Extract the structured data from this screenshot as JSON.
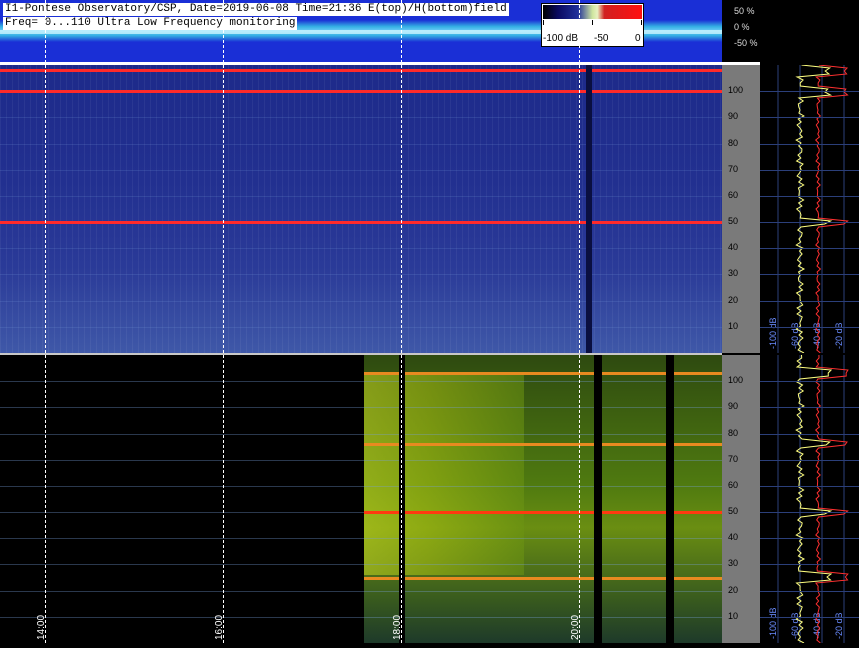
{
  "header": {
    "line1": "I1-Pontese Observatory/CSP, Date=2019-06-08 Time=21:36 E(top)/H(bottom)field",
    "line2": "Freq= 0...110 Ultra Low Frequency monitoring",
    "colorbar_labels": [
      "-100 dB",
      "-50",
      "0"
    ],
    "amplitude_scale": [
      "50 %",
      "0 %",
      "-50 %"
    ]
  },
  "chart_data": {
    "type": "heatmap",
    "title": "I1-Pontese Observatory/CSP, Date=2019-06-08 Time=21:36 E(top)/H(bottom)field",
    "subtitle": "Freq= 0...110 Ultra Low Frequency monitoring",
    "xlabel": "",
    "ylabel": "",
    "x_ticks": [
      "14:00",
      "16:00",
      "18:00",
      "20:00"
    ],
    "x_range": [
      "13:30",
      "21:36"
    ],
    "y_ticks": [
      10,
      20,
      30,
      40,
      50,
      60,
      70,
      80,
      90,
      100
    ],
    "ylim": [
      0,
      110
    ],
    "colorbar": {
      "min": -100,
      "max": 0,
      "ticks": [
        -100,
        -50,
        0
      ],
      "unit": "dB"
    },
    "panels": [
      {
        "name": "E(top)",
        "notable_lines_hz": [
          50,
          100,
          108
        ],
        "data_start": "13:30"
      },
      {
        "name": "H(bottom)",
        "notable_lines_hz": [
          25,
          50,
          76,
          103
        ],
        "data_start": "17:35"
      }
    ],
    "spectrum_x_ticks": [
      "-100 dB",
      "-60 dB",
      "-40 dB",
      "-20 dB"
    ],
    "colors": {
      "E_background": "#223090",
      "H_background": "#4f7a10",
      "line": "#ff2020",
      "spectrum_a": "#ffff80",
      "spectrum_b": "#ff3030"
    }
  }
}
